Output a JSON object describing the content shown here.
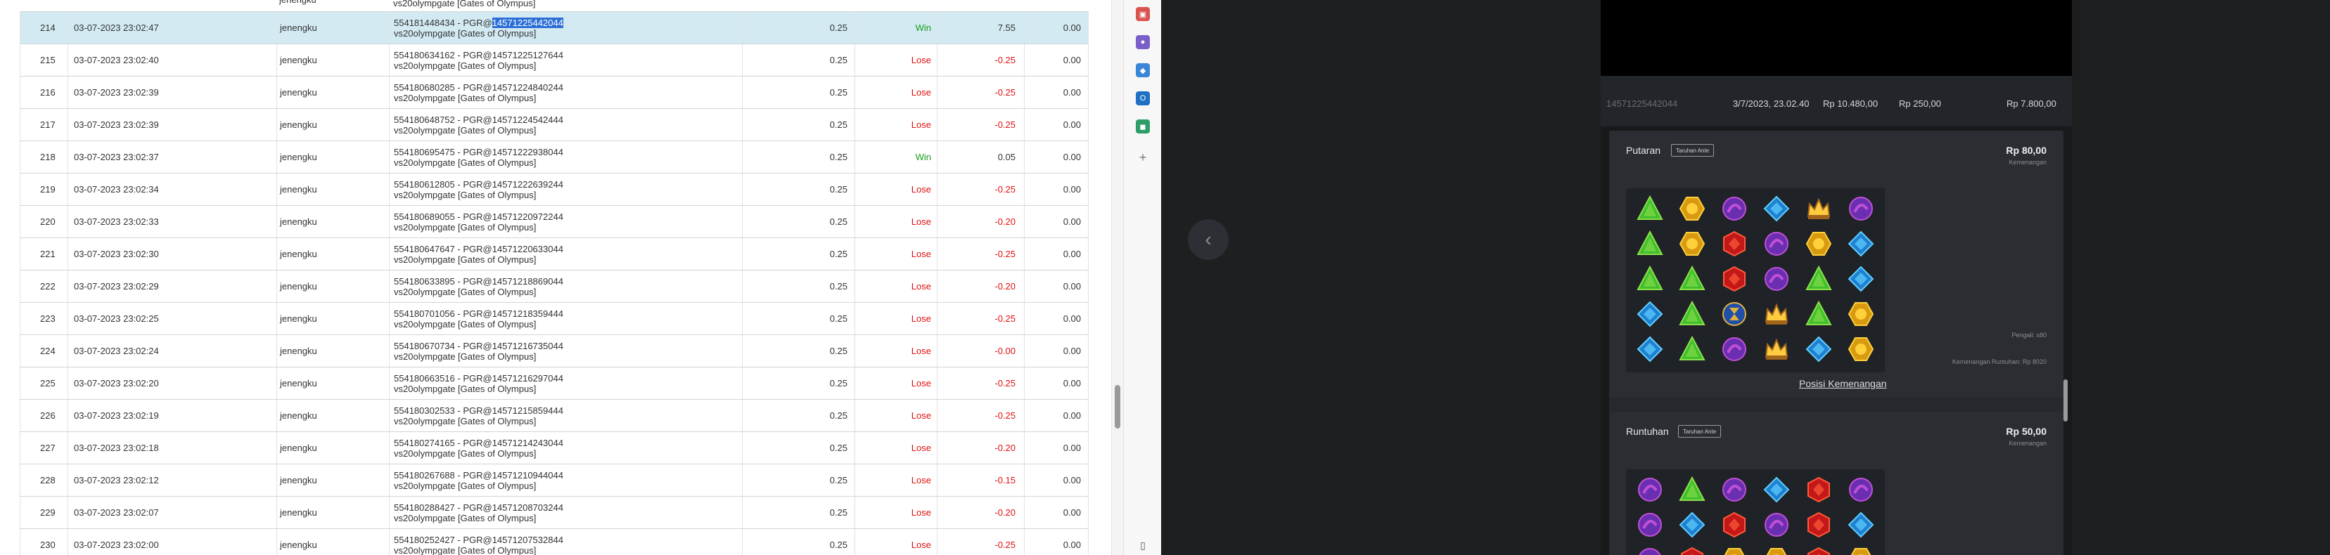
{
  "top_stub": {
    "user": "jenengku",
    "desc": "vs20olympgate [Gates of Olympus]"
  },
  "rows": [
    {
      "no": "214",
      "date": "03-07-2023 23:02:47",
      "user": "jenengku",
      "id": "554181448434",
      "ref_pre": "PGR@",
      "ref": "14571225442044",
      "game": "vs20olympgate [Gates of Olympus]",
      "bet": "0.25",
      "result": "Win",
      "amount": "7.55",
      "balance": "0.00",
      "highlight": true
    },
    {
      "no": "215",
      "date": "03-07-2023 23:02:40",
      "user": "jenengku",
      "id": "554180634162",
      "ref_pre": "PGR@",
      "ref": "14571225127644",
      "game": "vs20olympgate [Gates of Olympus]",
      "bet": "0.25",
      "result": "Lose",
      "amount": "-0.25",
      "balance": "0.00"
    },
    {
      "no": "216",
      "date": "03-07-2023 23:02:39",
      "user": "jenengku",
      "id": "554180680285",
      "ref_pre": "PGR@",
      "ref": "14571224840244",
      "game": "vs20olympgate [Gates of Olympus]",
      "bet": "0.25",
      "result": "Lose",
      "amount": "-0.25",
      "balance": "0.00"
    },
    {
      "no": "217",
      "date": "03-07-2023 23:02:39",
      "user": "jenengku",
      "id": "554180648752",
      "ref_pre": "PGR@",
      "ref": "14571224542444",
      "game": "vs20olympgate [Gates of Olympus]",
      "bet": "0.25",
      "result": "Lose",
      "amount": "-0.25",
      "balance": "0.00"
    },
    {
      "no": "218",
      "date": "03-07-2023 23:02:37",
      "user": "jenengku",
      "id": "554180695475",
      "ref_pre": "PGR@",
      "ref": "14571222938044",
      "game": "vs20olympgate [Gates of Olympus]",
      "bet": "0.25",
      "result": "Win",
      "amount": "0.05",
      "balance": "0.00"
    },
    {
      "no": "219",
      "date": "03-07-2023 23:02:34",
      "user": "jenengku",
      "id": "554180612805",
      "ref_pre": "PGR@",
      "ref": "14571222639244",
      "game": "vs20olympgate [Gates of Olympus]",
      "bet": "0.25",
      "result": "Lose",
      "amount": "-0.25",
      "balance": "0.00"
    },
    {
      "no": "220",
      "date": "03-07-2023 23:02:33",
      "user": "jenengku",
      "id": "554180689055",
      "ref_pre": "PGR@",
      "ref": "14571220972244",
      "game": "vs20olympgate [Gates of Olympus]",
      "bet": "0.25",
      "result": "Lose",
      "amount": "-0.20",
      "balance": "0.00"
    },
    {
      "no": "221",
      "date": "03-07-2023 23:02:30",
      "user": "jenengku",
      "id": "554180647647",
      "ref_pre": "PGR@",
      "ref": "14571220633044",
      "game": "vs20olympgate [Gates of Olympus]",
      "bet": "0.25",
      "result": "Lose",
      "amount": "-0.25",
      "balance": "0.00"
    },
    {
      "no": "222",
      "date": "03-07-2023 23:02:29",
      "user": "jenengku",
      "id": "554180633895",
      "ref_pre": "PGR@",
      "ref": "14571218869044",
      "game": "vs20olympgate [Gates of Olympus]",
      "bet": "0.25",
      "result": "Lose",
      "amount": "-0.20",
      "balance": "0.00"
    },
    {
      "no": "223",
      "date": "03-07-2023 23:02:25",
      "user": "jenengku",
      "id": "554180701056",
      "ref_pre": "PGR@",
      "ref": "14571218359444",
      "game": "vs20olympgate [Gates of Olympus]",
      "bet": "0.25",
      "result": "Lose",
      "amount": "-0.25",
      "balance": "0.00"
    },
    {
      "no": "224",
      "date": "03-07-2023 23:02:24",
      "user": "jenengku",
      "id": "554180670734",
      "ref_pre": "PGR@",
      "ref": "14571216735044",
      "game": "vs20olympgate [Gates of Olympus]",
      "bet": "0.25",
      "result": "Lose",
      "amount": "-0.00",
      "balance": "0.00"
    },
    {
      "no": "225",
      "date": "03-07-2023 23:02:20",
      "user": "jenengku",
      "id": "554180663516",
      "ref_pre": "PGR@",
      "ref": "14571216297044",
      "game": "vs20olympgate [Gates of Olympus]",
      "bet": "0.25",
      "result": "Lose",
      "amount": "-0.25",
      "balance": "0.00"
    },
    {
      "no": "226",
      "date": "03-07-2023 23:02:19",
      "user": "jenengku",
      "id": "554180302533",
      "ref_pre": "PGR@",
      "ref": "14571215859444",
      "game": "vs20olympgate [Gates of Olympus]",
      "bet": "0.25",
      "result": "Lose",
      "amount": "-0.25",
      "balance": "0.00"
    },
    {
      "no": "227",
      "date": "03-07-2023 23:02:18",
      "user": "jenengku",
      "id": "554180274165",
      "ref_pre": "PGR@",
      "ref": "14571214243044",
      "game": "vs20olympgate [Gates of Olympus]",
      "bet": "0.25",
      "result": "Lose",
      "amount": "-0.20",
      "balance": "0.00"
    },
    {
      "no": "228",
      "date": "03-07-2023 23:02:12",
      "user": "jenengku",
      "id": "554180267688",
      "ref_pre": "PGR@",
      "ref": "14571210944044",
      "game": "vs20olympgate [Gates of Olympus]",
      "bet": "0.25",
      "result": "Lose",
      "amount": "-0.15",
      "balance": "0.00"
    },
    {
      "no": "229",
      "date": "03-07-2023 23:02:07",
      "user": "jenengku",
      "id": "554180288427",
      "ref_pre": "PGR@",
      "ref": "14571208703244",
      "game": "vs20olympgate [Gates of Olympus]",
      "bet": "0.25",
      "result": "Lose",
      "amount": "-0.20",
      "balance": "0.00"
    },
    {
      "no": "230",
      "date": "03-07-2023 23:02:00",
      "user": "jenengku",
      "id": "554180252427",
      "ref_pre": "PGR@",
      "ref": "14571207532844",
      "game": "vs20olympgate [Gates of Olympus]",
      "bet": "0.25",
      "result": "Lose",
      "amount": "-0.25",
      "balance": "0.00"
    }
  ],
  "sidebar": {
    "icons": [
      {
        "name": "gift-icon",
        "color": "#d9534f",
        "glyph": "▣"
      },
      {
        "name": "profile-badge-icon",
        "color": "#7b5fc9",
        "glyph": "●"
      },
      {
        "name": "extension-icon",
        "color": "#3a86d8",
        "glyph": "◆"
      },
      {
        "name": "outlook-icon",
        "color": "#1f6fc4",
        "glyph": "O"
      },
      {
        "name": "shopping-cart-icon",
        "color": "#2e9d6a",
        "glyph": "◼"
      },
      {
        "name": "add-icon",
        "color": "#777777",
        "glyph": "+"
      }
    ],
    "bottom_icon": {
      "name": "sidebar-toggle-icon",
      "glyph": "▯"
    }
  },
  "viewer": {
    "summary": {
      "round_id": "14571225442044",
      "datetime": "3/7/2023, 23.02.40",
      "balance": "Rp 10.480,00",
      "bet": "Rp 250,00",
      "win": "Rp 7.800,00"
    },
    "spin_card": {
      "title": "Putaran",
      "tag": "Taruhan Ante",
      "amount": "Rp 80,00",
      "amount_label": "Kemenangan",
      "multiplier_label": "Pengali: x80",
      "tumble_win": "Kemenangan Runtuhan: Rp 8020",
      "position_link": "Posisi Kemenangan",
      "grid": [
        [
          "green",
          "gold",
          "purple",
          "blue",
          "crown",
          "purple"
        ],
        [
          "green",
          "gold",
          "red",
          "purple",
          "gold",
          "blue"
        ],
        [
          "green",
          "green",
          "red",
          "purple",
          "green",
          "blue"
        ],
        [
          "blue",
          "green",
          "hourglass",
          "crown",
          "green",
          "gold"
        ],
        [
          "blue",
          "green",
          "purple",
          "crown",
          "blue",
          "gold"
        ]
      ]
    },
    "tumble_card": {
      "title": "Runtuhan",
      "tag": "Taruhan Ante",
      "amount": "Rp 50,00",
      "amount_label": "Kemenangan",
      "grid": [
        [
          "purple",
          "green",
          "purple",
          "blue",
          "red",
          "purple"
        ],
        [
          "purple",
          "blue",
          "red",
          "purple",
          "red",
          "blue"
        ],
        [
          "purple",
          "red",
          "gold",
          "gold",
          "red",
          "gold"
        ]
      ]
    }
  }
}
